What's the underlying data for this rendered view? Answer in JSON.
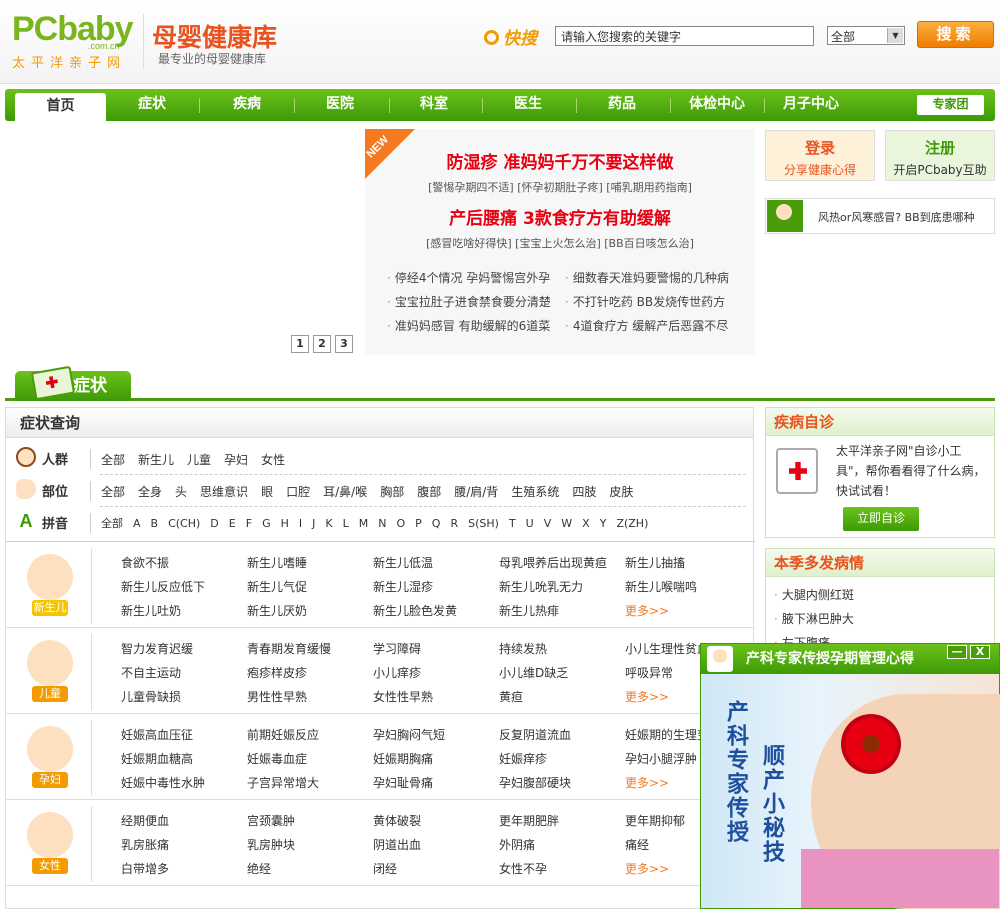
{
  "header": {
    "logo_main": "PCbaby",
    "logo_domain": ".com.cn",
    "logo_cn": "太平洋亲子网",
    "site_title": "母婴健康库",
    "site_subtitle": "最专业的母婴健康库",
    "quick_label": "快搜",
    "search_placeholder": "请输入您搜索的关键字",
    "search_scope": "全部",
    "search_button": "搜索"
  },
  "nav": {
    "items": [
      "首页",
      "症状",
      "疾病",
      "医院",
      "科室",
      "医生",
      "药品",
      "体检中心",
      "月子中心"
    ],
    "expert": "专家团"
  },
  "promo": {
    "new_tag": "NEW",
    "headline1": "防湿疹 准妈妈千万不要这样做",
    "sub1": "[警惕孕期四不适] [怀孕初期肚子疼] [哺乳期用药指南]",
    "headline2": "产后腰痛 3款食疗方有助缓解",
    "sub2": "[感冒吃啥好得快] [宝宝上火怎么治] [BB百日咳怎么治]",
    "links": [
      "停经4个情况 孕妈警惕宫外孕",
      "细数春天准妈要警惕的几种病",
      "宝宝拉肚子进食禁食要分清楚",
      "不打针吃药 BB发烧传世药方",
      "准妈妈感冒 有助缓解的6道菜",
      "4道食疗方 缓解产后恶露不尽"
    ],
    "pages": [
      "1",
      "2",
      "3"
    ]
  },
  "account": {
    "login_title": "登录",
    "login_sub": "分享健康心得",
    "register_title": "注册",
    "register_sub": "开启PCbaby互助",
    "qa": "风热or风寒感冒? BB到底患哪种"
  },
  "section": {
    "title": "症状"
  },
  "query": {
    "title": "症状查询",
    "rows": [
      {
        "label": "人群",
        "options": [
          "全部",
          "新生儿",
          "儿童",
          "孕妇",
          "女性"
        ]
      },
      {
        "label": "部位",
        "options": [
          "全部",
          "全身",
          "头",
          "思维意识",
          "眼",
          "口腔",
          "耳/鼻/喉",
          "胸部",
          "腹部",
          "腰/肩/背",
          "生殖系统",
          "四肢",
          "皮肤"
        ]
      },
      {
        "label": "拼音",
        "options": [
          "全部",
          "A",
          "B",
          "C(CH)",
          "D",
          "E",
          "F",
          "G",
          "H",
          "I",
          "J",
          "K",
          "L",
          "M",
          "N",
          "O",
          "P",
          "Q",
          "R",
          "S(SH)",
          "T",
          "U",
          "V",
          "W",
          "X",
          "Y",
          "Z(ZH)"
        ]
      }
    ],
    "groups": [
      {
        "label": "新生儿",
        "items": [
          "食欲不振",
          "新生儿嗜睡",
          "新生儿低温",
          "母乳喂养后出现黄疸",
          "新生儿抽搐",
          "新生儿反应低下",
          "新生儿气促",
          "新生儿湿疹",
          "新生儿吮乳无力",
          "新生儿喉喘鸣",
          "新生儿吐奶",
          "新生儿厌奶",
          "新生儿脸色发黄",
          "新生儿热痱",
          "更多>>"
        ]
      },
      {
        "label": "儿童",
        "items": [
          "智力发育迟缓",
          "青春期发育缓慢",
          "学习障碍",
          "持续发热",
          "小儿生理性贫血",
          "不自主运动",
          "疱疹样皮疹",
          "小儿痒疹",
          "小儿维D缺乏",
          "呼吸异常",
          "儿童骨缺损",
          "男性性早熟",
          "女性性早熟",
          "黄疸",
          "更多>>"
        ]
      },
      {
        "label": "孕妇",
        "items": [
          "妊娠高血压征",
          "前期妊娠反应",
          "孕妇胸闷气短",
          "反复阴道流血",
          "妊娠期的生理变化",
          "妊娠期血糖高",
          "妊娠毒血症",
          "妊娠期胸痛",
          "妊娠痒疹",
          "孕妇小腿浮肿",
          "妊娠中毒性水肿",
          "子宫异常增大",
          "孕妇耻骨痛",
          "孕妇腹部硬块",
          "更多>>"
        ]
      },
      {
        "label": "女性",
        "items": [
          "经期便血",
          "宫颈囊肿",
          "黄体破裂",
          "更年期肥胖",
          "更年期抑郁",
          "乳房胀痛",
          "乳房肿块",
          "阴道出血",
          "外阴痛",
          "痛经",
          "白带增多",
          "绝经",
          "闭经",
          "女性不孕",
          "更多>>"
        ]
      }
    ]
  },
  "self_check": {
    "title": "疾病自诊",
    "desc": "太平洋亲子网\"自诊小工具\"，帮你看看得了什么病，快试试看！",
    "button": "立即自诊"
  },
  "season": {
    "title": "本季多发病情",
    "items": [
      "大腿内侧红斑",
      "腋下淋巴肿大",
      "左下腹痛"
    ]
  },
  "popup": {
    "title": "产科专家传授孕期管理心得",
    "min": "—",
    "close": "X",
    "text1": "产科专家传授",
    "text2": "顺产小秘技"
  },
  "colors": {
    "brand_green": "#3d9a06",
    "brand_orange": "#f39b00",
    "headline_red": "#e60012",
    "title_orange": "#e8531f"
  }
}
